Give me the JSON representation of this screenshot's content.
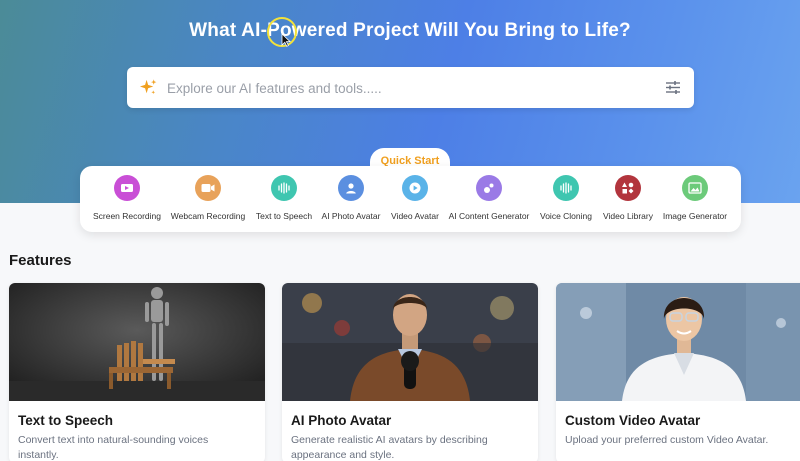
{
  "hero": {
    "title": "What AI-Powered Project Will You Bring to Life?"
  },
  "search": {
    "placeholder": "Explore our AI features and tools.....",
    "value": ""
  },
  "quick_start": {
    "label": "Quick Start",
    "items": [
      {
        "label": "Screen Recording",
        "icon": "screen-record-icon",
        "color": "#c94fd6"
      },
      {
        "label": "Webcam Recording",
        "icon": "webcam-icon",
        "color": "#e8a25a"
      },
      {
        "label": "Text to Speech",
        "icon": "waveform-icon",
        "color": "#3fc6b0"
      },
      {
        "label": "AI Photo Avatar",
        "icon": "person-icon",
        "color": "#5b8fe0"
      },
      {
        "label": "Video Avatar",
        "icon": "play-icon",
        "color": "#5ab3e8"
      },
      {
        "label": "AI Content Generator",
        "icon": "bubbles-icon",
        "color": "#9a7ae6"
      },
      {
        "label": "Voice Cloning",
        "icon": "waveform-icon",
        "color": "#3fc6b0"
      },
      {
        "label": "Video Library",
        "icon": "shapes-icon",
        "color": "#b2353d"
      },
      {
        "label": "Image Generator",
        "icon": "image-icon",
        "color": "#6cca7a"
      }
    ]
  },
  "features": {
    "title": "Features",
    "cards": [
      {
        "title": "Text to Speech",
        "description": "Convert text into natural-sounding voices instantly."
      },
      {
        "title": "AI Photo Avatar",
        "description": "Generate realistic AI avatars by describing appearance and style."
      },
      {
        "title": "Custom Video Avatar",
        "description": "Upload your preferred custom Video Avatar."
      }
    ]
  },
  "colors": {
    "accent": "#4d7fe6",
    "quick_start_label": "#f0a020"
  }
}
